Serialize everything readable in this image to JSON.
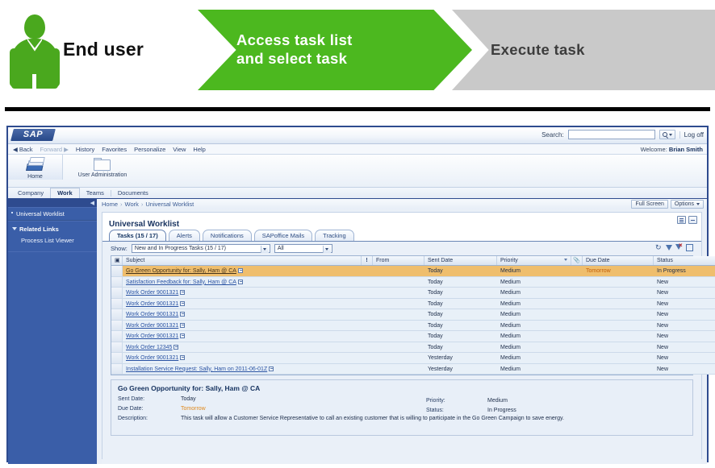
{
  "banner": {
    "actor_label": "End user",
    "steps": [
      {
        "label": "Access task list\nand select task",
        "state": "active",
        "color": "#4cb81f"
      },
      {
        "label": "Execute task",
        "state": "inactive",
        "color": "#c9c9c9"
      }
    ],
    "step1_line1": "Access task list",
    "step1_line2": "and select task",
    "step2_label": "Execute task"
  },
  "portal": {
    "logo_text": "SAP",
    "search_label": "Search:",
    "search_value": "",
    "search_go": "",
    "logoff_label": "Log off",
    "welcome_prefix": "Welcome: ",
    "welcome_user": "Brian Smith",
    "nav_links": [
      "◀ Back",
      "Forward ▶",
      "History",
      "Favorites",
      "Personalize",
      "View",
      "Help"
    ],
    "roles": [
      {
        "label": "Home",
        "icon": "home-icon",
        "selected": true
      },
      {
        "label": "User Administration",
        "icon": "folder-icon",
        "selected": false
      }
    ],
    "l1_tabs": [
      {
        "label": "Company",
        "selected": false
      },
      {
        "label": "Work",
        "selected": true
      },
      {
        "label": "Teams",
        "selected": false
      },
      {
        "label": "Documents",
        "selected": false
      }
    ]
  },
  "sidebar": {
    "items": [
      {
        "label": "Universal Worklist",
        "selected": true
      }
    ],
    "group_label": "Related Links",
    "sub_items": [
      {
        "label": "Process List Viewer"
      }
    ]
  },
  "breadcrumb": {
    "items": [
      "Home",
      "Work",
      "Universal Worklist"
    ],
    "sep": "›",
    "full_screen_label": "Full Screen",
    "options_label": "Options"
  },
  "panel": {
    "title": "Universal Worklist",
    "tabs": [
      {
        "label": "Tasks  (15 / 17)",
        "selected": true
      },
      {
        "label": "Alerts",
        "selected": false
      },
      {
        "label": "Notifications",
        "selected": false
      },
      {
        "label": "SAPoffice Mails",
        "selected": false
      },
      {
        "label": "Tracking",
        "selected": false
      }
    ]
  },
  "filter": {
    "show_label": "Show:",
    "view_value": "New and In Progress Tasks  (15 / 17)",
    "scope_value": "All"
  },
  "table": {
    "columns": [
      {
        "key": "check",
        "label": ""
      },
      {
        "key": "subject",
        "label": "Subject"
      },
      {
        "key": "exclaim",
        "label": "!"
      },
      {
        "key": "from",
        "label": "From"
      },
      {
        "key": "sent",
        "label": "Sent Date"
      },
      {
        "key": "priority",
        "label": "Priority",
        "sorted": true
      },
      {
        "key": "attach",
        "label": ""
      },
      {
        "key": "due",
        "label": "Due Date"
      },
      {
        "key": "status",
        "label": "Status"
      }
    ],
    "rows": [
      {
        "subject": "Go Green Opportunity for: Sally, Ham @ CA",
        "from": "",
        "sent": "Today",
        "priority": "Medium",
        "due": "Tomorrow",
        "status": "In Progress",
        "selected": true
      },
      {
        "subject": "Satisfaction Feedback for: Sally, Ham @ CA",
        "from": "",
        "sent": "Today",
        "priority": "Medium",
        "due": "",
        "status": "New",
        "selected": false
      },
      {
        "subject": "Work Order 9001321",
        "from": "",
        "sent": "Today",
        "priority": "Medium",
        "due": "",
        "status": "New",
        "selected": false
      },
      {
        "subject": "Work Order 9001321",
        "from": "",
        "sent": "Today",
        "priority": "Medium",
        "due": "",
        "status": "New",
        "selected": false
      },
      {
        "subject": "Work Order 9001321",
        "from": "",
        "sent": "Today",
        "priority": "Medium",
        "due": "",
        "status": "New",
        "selected": false
      },
      {
        "subject": "Work Order 9001321",
        "from": "",
        "sent": "Today",
        "priority": "Medium",
        "due": "",
        "status": "New",
        "selected": false
      },
      {
        "subject": "Work Order 9001321",
        "from": "",
        "sent": "Today",
        "priority": "Medium",
        "due": "",
        "status": "New",
        "selected": false
      },
      {
        "subject": "Work Order 12345",
        "from": "",
        "sent": "Today",
        "priority": "Medium",
        "due": "",
        "status": "New",
        "selected": false
      },
      {
        "subject": "Work Order 9001321",
        "from": "",
        "sent": "Yesterday",
        "priority": "Medium",
        "due": "",
        "status": "New",
        "selected": false
      },
      {
        "subject": "Installation Service Request: Sally, Ham on 2011-06-01Z",
        "from": "",
        "sent": "Yesterday",
        "priority": "Medium",
        "due": "",
        "status": "New",
        "selected": false
      }
    ]
  },
  "detail": {
    "title": "Go Green Opportunity for: Sally, Ham @ CA",
    "sent_date_label": "Sent Date:",
    "sent_date_value": "Today",
    "due_date_label": "Due Date:",
    "due_date_value": "Tomorrow",
    "description_label": "Description:",
    "description_value": "This task will allow a Customer Service Representative to call an existing customer that is willing to participate in the Go Green Campaign to save energy.",
    "priority_label": "Priority:",
    "priority_value": "Medium",
    "status_label": "Status:",
    "status_value": "In Progress"
  }
}
